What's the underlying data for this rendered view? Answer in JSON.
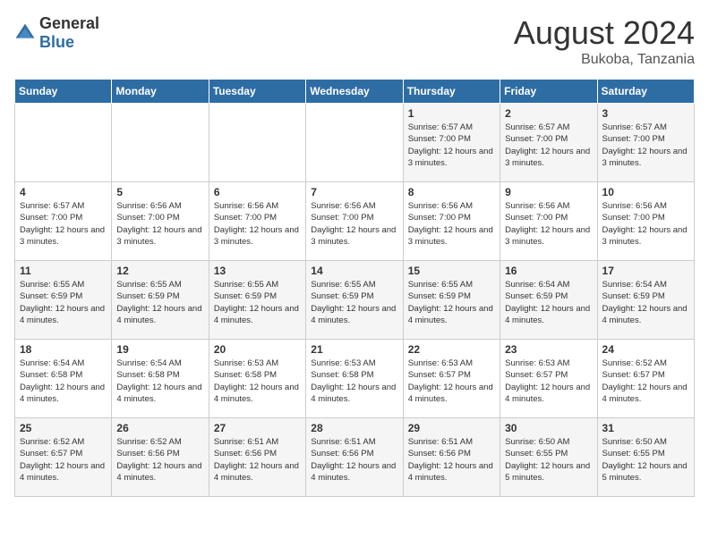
{
  "logo": {
    "general": "General",
    "blue": "Blue"
  },
  "title": "August 2024",
  "subtitle": "Bukoba, Tanzania",
  "days_of_week": [
    "Sunday",
    "Monday",
    "Tuesday",
    "Wednesday",
    "Thursday",
    "Friday",
    "Saturday"
  ],
  "weeks": [
    [
      {
        "day": "",
        "sunrise": "",
        "sunset": "",
        "daylight": ""
      },
      {
        "day": "",
        "sunrise": "",
        "sunset": "",
        "daylight": ""
      },
      {
        "day": "",
        "sunrise": "",
        "sunset": "",
        "daylight": ""
      },
      {
        "day": "",
        "sunrise": "",
        "sunset": "",
        "daylight": ""
      },
      {
        "day": "1",
        "sunrise": "Sunrise: 6:57 AM",
        "sunset": "Sunset: 7:00 PM",
        "daylight": "Daylight: 12 hours and 3 minutes."
      },
      {
        "day": "2",
        "sunrise": "Sunrise: 6:57 AM",
        "sunset": "Sunset: 7:00 PM",
        "daylight": "Daylight: 12 hours and 3 minutes."
      },
      {
        "day": "3",
        "sunrise": "Sunrise: 6:57 AM",
        "sunset": "Sunset: 7:00 PM",
        "daylight": "Daylight: 12 hours and 3 minutes."
      }
    ],
    [
      {
        "day": "4",
        "sunrise": "Sunrise: 6:57 AM",
        "sunset": "Sunset: 7:00 PM",
        "daylight": "Daylight: 12 hours and 3 minutes."
      },
      {
        "day": "5",
        "sunrise": "Sunrise: 6:56 AM",
        "sunset": "Sunset: 7:00 PM",
        "daylight": "Daylight: 12 hours and 3 minutes."
      },
      {
        "day": "6",
        "sunrise": "Sunrise: 6:56 AM",
        "sunset": "Sunset: 7:00 PM",
        "daylight": "Daylight: 12 hours and 3 minutes."
      },
      {
        "day": "7",
        "sunrise": "Sunrise: 6:56 AM",
        "sunset": "Sunset: 7:00 PM",
        "daylight": "Daylight: 12 hours and 3 minutes."
      },
      {
        "day": "8",
        "sunrise": "Sunrise: 6:56 AM",
        "sunset": "Sunset: 7:00 PM",
        "daylight": "Daylight: 12 hours and 3 minutes."
      },
      {
        "day": "9",
        "sunrise": "Sunrise: 6:56 AM",
        "sunset": "Sunset: 7:00 PM",
        "daylight": "Daylight: 12 hours and 3 minutes."
      },
      {
        "day": "10",
        "sunrise": "Sunrise: 6:56 AM",
        "sunset": "Sunset: 7:00 PM",
        "daylight": "Daylight: 12 hours and 3 minutes."
      }
    ],
    [
      {
        "day": "11",
        "sunrise": "Sunrise: 6:55 AM",
        "sunset": "Sunset: 6:59 PM",
        "daylight": "Daylight: 12 hours and 4 minutes."
      },
      {
        "day": "12",
        "sunrise": "Sunrise: 6:55 AM",
        "sunset": "Sunset: 6:59 PM",
        "daylight": "Daylight: 12 hours and 4 minutes."
      },
      {
        "day": "13",
        "sunrise": "Sunrise: 6:55 AM",
        "sunset": "Sunset: 6:59 PM",
        "daylight": "Daylight: 12 hours and 4 minutes."
      },
      {
        "day": "14",
        "sunrise": "Sunrise: 6:55 AM",
        "sunset": "Sunset: 6:59 PM",
        "daylight": "Daylight: 12 hours and 4 minutes."
      },
      {
        "day": "15",
        "sunrise": "Sunrise: 6:55 AM",
        "sunset": "Sunset: 6:59 PM",
        "daylight": "Daylight: 12 hours and 4 minutes."
      },
      {
        "day": "16",
        "sunrise": "Sunrise: 6:54 AM",
        "sunset": "Sunset: 6:59 PM",
        "daylight": "Daylight: 12 hours and 4 minutes."
      },
      {
        "day": "17",
        "sunrise": "Sunrise: 6:54 AM",
        "sunset": "Sunset: 6:59 PM",
        "daylight": "Daylight: 12 hours and 4 minutes."
      }
    ],
    [
      {
        "day": "18",
        "sunrise": "Sunrise: 6:54 AM",
        "sunset": "Sunset: 6:58 PM",
        "daylight": "Daylight: 12 hours and 4 minutes."
      },
      {
        "day": "19",
        "sunrise": "Sunrise: 6:54 AM",
        "sunset": "Sunset: 6:58 PM",
        "daylight": "Daylight: 12 hours and 4 minutes."
      },
      {
        "day": "20",
        "sunrise": "Sunrise: 6:53 AM",
        "sunset": "Sunset: 6:58 PM",
        "daylight": "Daylight: 12 hours and 4 minutes."
      },
      {
        "day": "21",
        "sunrise": "Sunrise: 6:53 AM",
        "sunset": "Sunset: 6:58 PM",
        "daylight": "Daylight: 12 hours and 4 minutes."
      },
      {
        "day": "22",
        "sunrise": "Sunrise: 6:53 AM",
        "sunset": "Sunset: 6:57 PM",
        "daylight": "Daylight: 12 hours and 4 minutes."
      },
      {
        "day": "23",
        "sunrise": "Sunrise: 6:53 AM",
        "sunset": "Sunset: 6:57 PM",
        "daylight": "Daylight: 12 hours and 4 minutes."
      },
      {
        "day": "24",
        "sunrise": "Sunrise: 6:52 AM",
        "sunset": "Sunset: 6:57 PM",
        "daylight": "Daylight: 12 hours and 4 minutes."
      }
    ],
    [
      {
        "day": "25",
        "sunrise": "Sunrise: 6:52 AM",
        "sunset": "Sunset: 6:57 PM",
        "daylight": "Daylight: 12 hours and 4 minutes."
      },
      {
        "day": "26",
        "sunrise": "Sunrise: 6:52 AM",
        "sunset": "Sunset: 6:56 PM",
        "daylight": "Daylight: 12 hours and 4 minutes."
      },
      {
        "day": "27",
        "sunrise": "Sunrise: 6:51 AM",
        "sunset": "Sunset: 6:56 PM",
        "daylight": "Daylight: 12 hours and 4 minutes."
      },
      {
        "day": "28",
        "sunrise": "Sunrise: 6:51 AM",
        "sunset": "Sunset: 6:56 PM",
        "daylight": "Daylight: 12 hours and 4 minutes."
      },
      {
        "day": "29",
        "sunrise": "Sunrise: 6:51 AM",
        "sunset": "Sunset: 6:56 PM",
        "daylight": "Daylight: 12 hours and 4 minutes."
      },
      {
        "day": "30",
        "sunrise": "Sunrise: 6:50 AM",
        "sunset": "Sunset: 6:55 PM",
        "daylight": "Daylight: 12 hours and 5 minutes."
      },
      {
        "day": "31",
        "sunrise": "Sunrise: 6:50 AM",
        "sunset": "Sunset: 6:55 PM",
        "daylight": "Daylight: 12 hours and 5 minutes."
      }
    ]
  ]
}
